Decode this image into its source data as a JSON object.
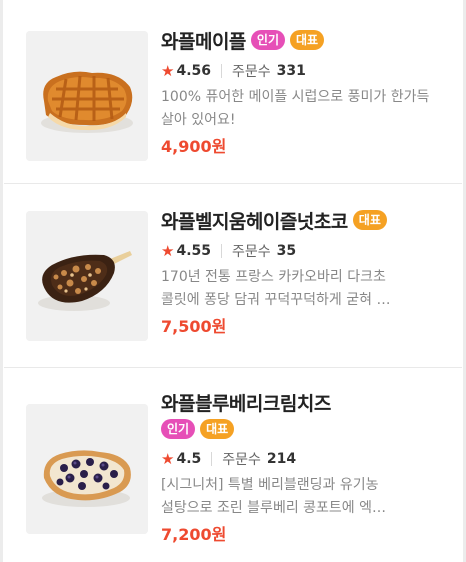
{
  "menu": {
    "items": [
      {
        "name": "와플메이플",
        "badges": {
          "popular": "인기",
          "representative": "대표"
        },
        "rating": "4.56",
        "orders_label": "주문수",
        "orders_count": "331",
        "description": "100% 퓨어한 메이플 시럽으로 풍미가 한가득 살아 있어요!",
        "price": "4,900원",
        "image_icon": "maple-waffle-photo"
      },
      {
        "name": "와플벨지움헤이즐넛초코",
        "badges": {
          "representative": "대표"
        },
        "rating": "4.55",
        "orders_label": "주문수",
        "orders_count": "35",
        "description_line1": "170년 전통 프랑스 카카오바리 다크초",
        "description_line2": "콜릿에 퐁당 담궈 꾸덕꾸덕하게 굳혀 …",
        "price": "7,500원",
        "image_icon": "chocolate-waffle-stick-photo"
      },
      {
        "name": "와플블루베리크림치즈",
        "badges": {
          "popular": "인기",
          "representative": "대표"
        },
        "rating": "4.5",
        "orders_label": "주문수",
        "orders_count": "214",
        "description_line1": "[시그니처] 특별 베리블랜딩과 유기농",
        "description_line2": "설탕으로 조린 블루베리 콩포트에 엑…",
        "price": "7,200원",
        "image_icon": "blueberry-waffle-photo"
      }
    ]
  },
  "colors": {
    "price": "#ee4a30",
    "star": "#ee4a30",
    "badge_popular": "#e64fb7",
    "badge_representative": "#f5a123"
  }
}
